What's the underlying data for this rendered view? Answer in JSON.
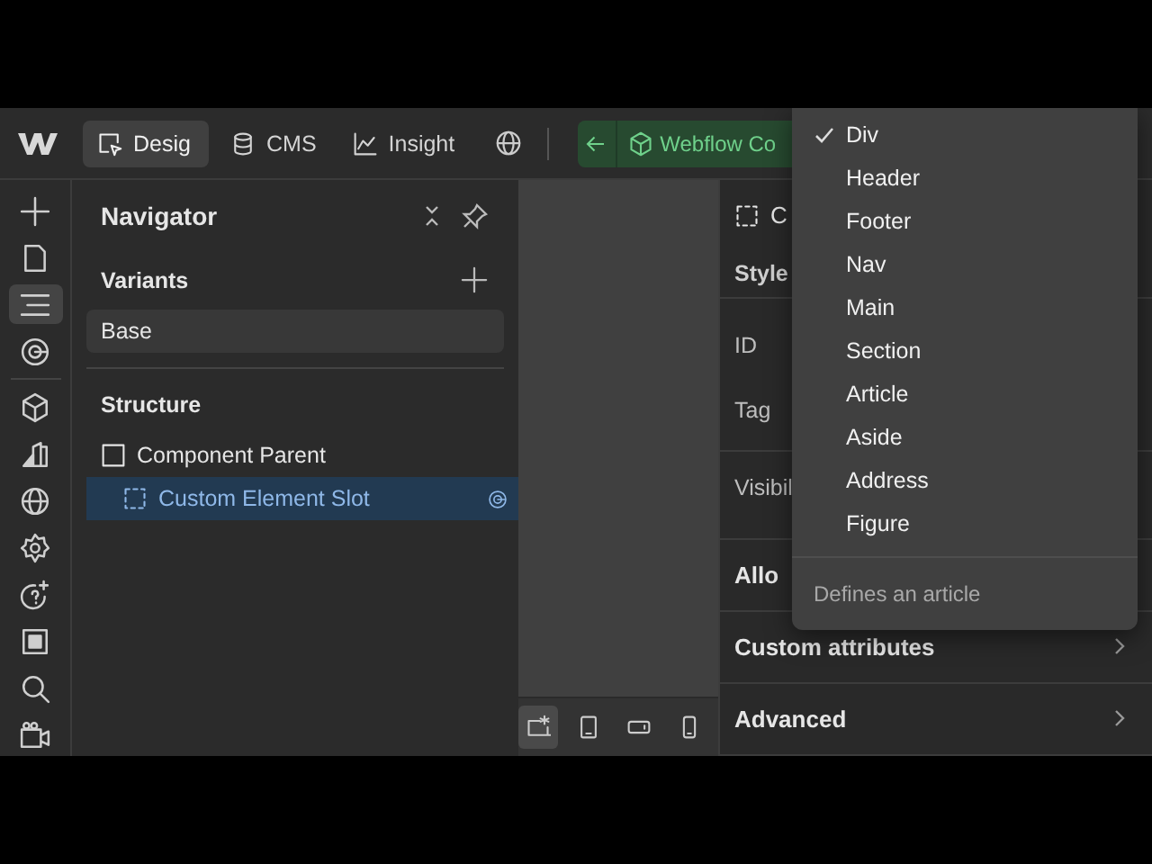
{
  "topbar": {
    "tabs": [
      {
        "label": "Desig",
        "selected": true
      },
      {
        "label": "CMS",
        "selected": false
      },
      {
        "label": "Insight",
        "selected": false
      }
    ],
    "breadcrumb": {
      "label": "Webflow Co"
    }
  },
  "rail": [
    {
      "selected": false
    },
    {
      "selected": false
    },
    {
      "selected": true
    },
    {
      "selected": false
    },
    {
      "selected": false
    },
    {
      "selected": false
    },
    {
      "selected": false
    },
    {
      "selected": false
    },
    {
      "selected": false
    },
    {
      "selected": false
    },
    {
      "selected": false
    },
    {
      "selected": false
    }
  ],
  "navigator": {
    "title": "Navigator",
    "variants_label": "Variants",
    "variant": "Base",
    "structure_label": "Structure",
    "tree": [
      {
        "label": "Component Parent",
        "kind": "component",
        "selected": false,
        "children": [
          {
            "label": "Custom Element Slot",
            "kind": "slot",
            "selected": true
          }
        ]
      }
    ]
  },
  "canvas": {
    "devices": [
      {
        "selected": true
      },
      {
        "selected": false
      },
      {
        "selected": false
      },
      {
        "selected": false
      }
    ]
  },
  "settings": {
    "element": "C",
    "style_label": "Style",
    "fields": [
      {
        "label": "ID"
      },
      {
        "label": "Tag"
      },
      {
        "label": "Visibil"
      }
    ],
    "sections": [
      {
        "label": "Allo",
        "chevron": false
      },
      {
        "label": "Custom attributes",
        "chevron": true
      },
      {
        "label": "Advanced",
        "chevron": true
      }
    ]
  },
  "tag_menu": {
    "options": [
      {
        "label": "Div",
        "selected": true
      },
      {
        "label": "Header",
        "selected": false
      },
      {
        "label": "Footer",
        "selected": false
      },
      {
        "label": "Nav",
        "selected": false
      },
      {
        "label": "Main",
        "selected": false
      },
      {
        "label": "Section",
        "selected": false
      },
      {
        "label": "Article",
        "selected": false
      },
      {
        "label": "Aside",
        "selected": false
      },
      {
        "label": "Address",
        "selected": false
      },
      {
        "label": "Figure",
        "selected": false
      }
    ],
    "description": "Defines an article"
  }
}
